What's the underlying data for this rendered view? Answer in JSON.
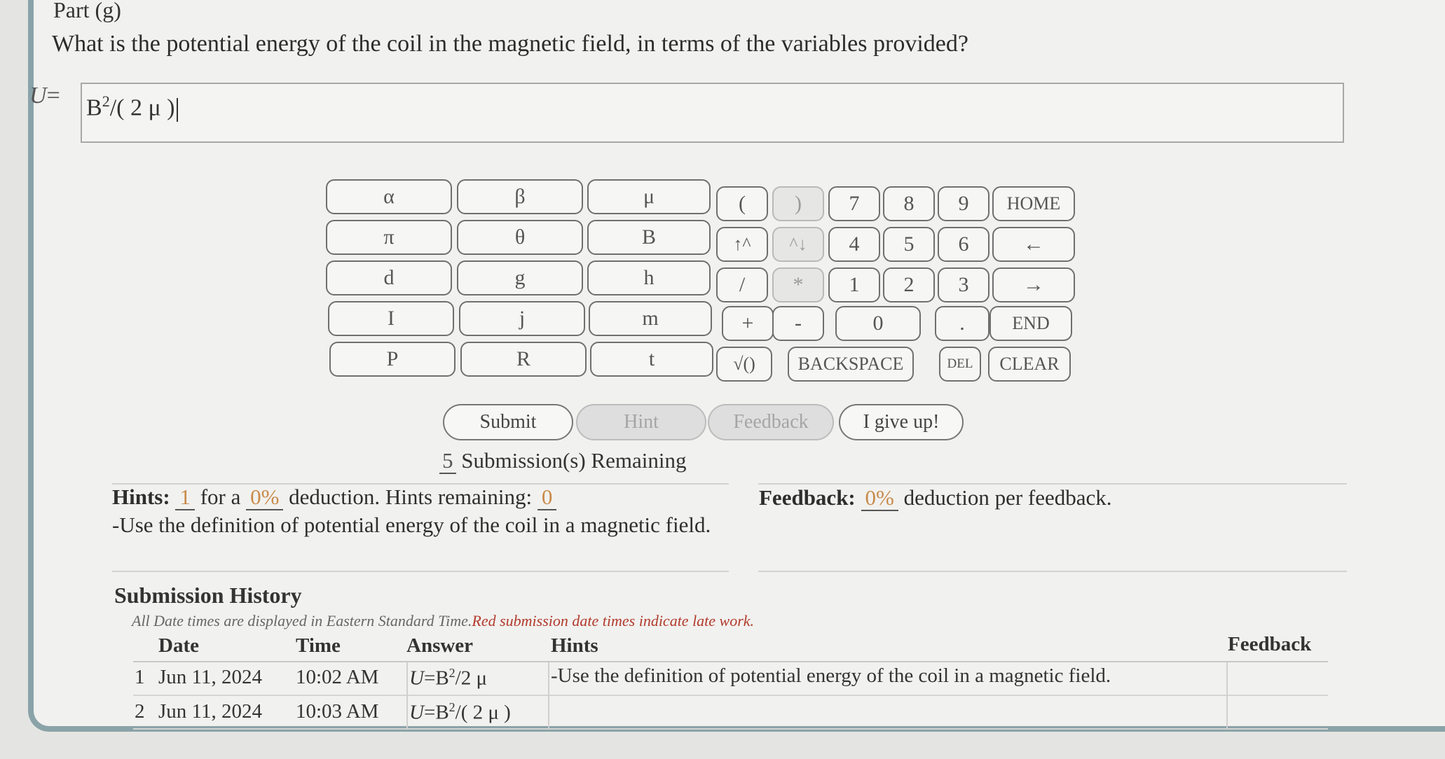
{
  "part_title": "Part (g)",
  "question": "What is the potential energy of the coil in the magnetic field, in terms of the variables provided?",
  "answer_label": "U",
  "answer_eq": "=",
  "answer_field": {
    "base": "B",
    "exp": "2",
    "rest": "/( 2 μ )"
  },
  "keypad": {
    "greek": [
      "α",
      "β",
      "μ",
      "π",
      "θ",
      "B",
      "d",
      "g",
      "h",
      "I",
      "j",
      "m",
      "P",
      "R",
      "t"
    ],
    "ops": [
      "(",
      ")",
      "↑^",
      "^↓",
      "/",
      "*",
      "+",
      "-",
      "√()"
    ],
    "digits": [
      "7",
      "8",
      "9",
      "4",
      "5",
      "6",
      "1",
      "2",
      "3",
      "0",
      "."
    ],
    "nav": [
      "HOME",
      "←",
      "→",
      "END",
      "CLEAR"
    ],
    "backspace": "BACKSPACE",
    "del": "DEL"
  },
  "actions": {
    "submit": "Submit",
    "hint": "Hint",
    "feedback": "Feedback",
    "give_up": "I give up!"
  },
  "submissions": {
    "count": "5",
    "label": "Submission(s) Remaining"
  },
  "hints": {
    "label": "Hints:",
    "count": "1",
    "for_a": "for a",
    "deduction_pct": "0%",
    "deduction_text": "deduction. Hints remaining:",
    "remaining": "0",
    "text": "-Use the definition of potential energy of the coil in a magnetic field."
  },
  "feedback": {
    "label": "Feedback:",
    "pct": "0%",
    "text": "deduction per feedback."
  },
  "history": {
    "title": "Submission History",
    "note": "All Date times are displayed in Eastern Standard Time.",
    "note_red": "Red submission date times indicate late work.",
    "headers": {
      "date": "Date",
      "time": "Time",
      "answer": "Answer",
      "hints": "Hints",
      "feedback": "Feedback"
    },
    "rows": [
      {
        "n": "1",
        "date": "Jun 11, 2024",
        "time": "10:02 AM",
        "answer_u": "U",
        "answer_eq": "=",
        "answer_base": "B",
        "answer_exp": "2",
        "answer_rest": "/2 μ",
        "hint": "-Use the definition of potential energy of the coil in a magnetic field."
      },
      {
        "n": "2",
        "date": "Jun 11, 2024",
        "time": "10:03 AM",
        "answer_u": "U",
        "answer_eq": "=",
        "answer_base": "B",
        "answer_exp": "2",
        "answer_rest": "/( 2 μ )",
        "hint": ""
      }
    ]
  },
  "colors": {
    "panel_border": "#8aa3a8",
    "late_red": "#b23a2c",
    "deduction_orange": "#c98a4a"
  }
}
